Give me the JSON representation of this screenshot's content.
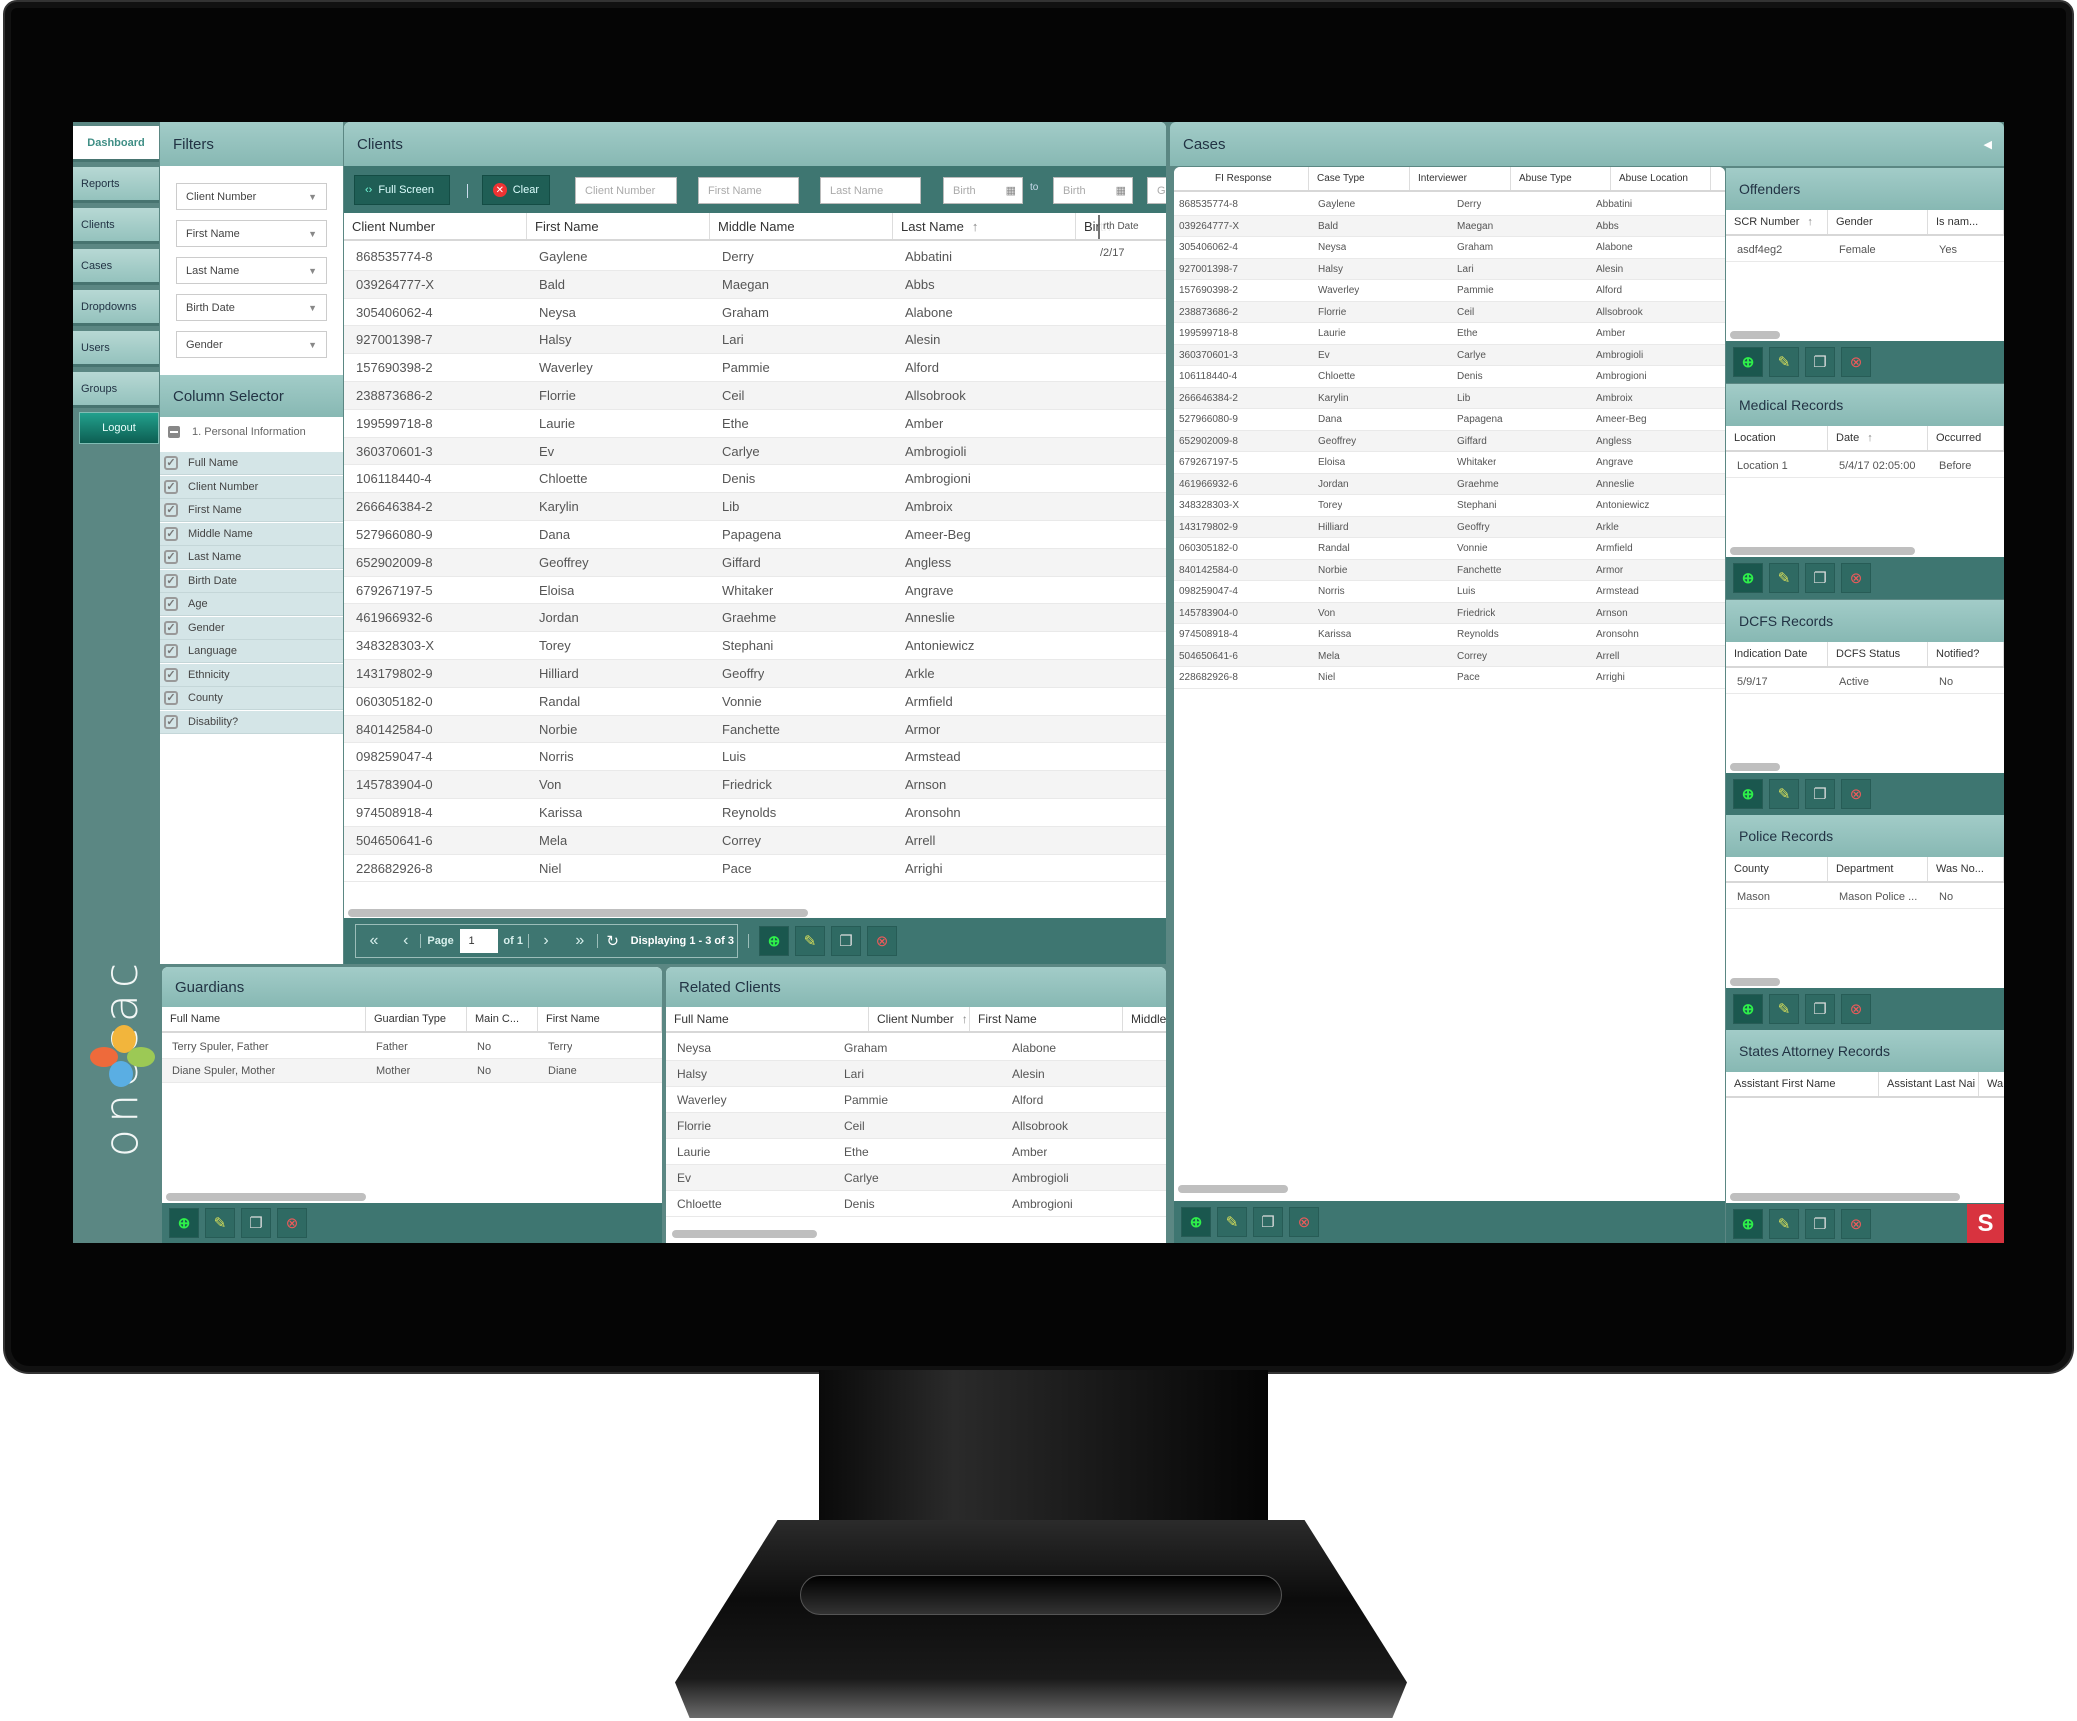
{
  "nav": {
    "items": [
      "Dashboard",
      "Reports",
      "Clients",
      "Cases",
      "Dropdowns",
      "Users",
      "Groups"
    ],
    "active": "Dashboard",
    "logout": "Logout"
  },
  "logo": {
    "text": "onecac",
    "tm": "™"
  },
  "filters": {
    "title": "Filters",
    "dropdowns": [
      "Client Number",
      "First Name",
      "Last Name",
      "Birth Date",
      "Gender"
    ]
  },
  "column_selector": {
    "title": "Column Selector",
    "group": "1. Personal Information",
    "items": [
      "Full Name",
      "Client Number",
      "First Name",
      "Middle Name",
      "Last Name",
      "Birth Date",
      "Age",
      "Gender",
      "Language",
      "Ethnicity",
      "County",
      "Disability?"
    ]
  },
  "clients": {
    "title": "Clients",
    "toolbar": {
      "full_screen": "Full Screen",
      "clear": "Clear",
      "client_number_placeholder": "Client Number",
      "first_name_placeholder": "First Name",
      "last_name_placeholder": "Last Name",
      "birth_from_placeholder": "Birth",
      "to": "to",
      "birth_to_placeholder": "Birth",
      "next_field_partial": "G"
    },
    "columns": [
      "Client Number",
      "First Name",
      "Middle Name",
      "Last Name",
      "Birth"
    ],
    "sorted_column": "Last Name",
    "dragged_header": "rth Date",
    "birth_partial_value": "/2/17",
    "rows": [
      [
        "868535774-8",
        "Gaylene",
        "Derry",
        "Abbatini"
      ],
      [
        "039264777-X",
        "Bald",
        "Maegan",
        "Abbs"
      ],
      [
        "305406062-4",
        "Neysa",
        "Graham",
        "Alabone"
      ],
      [
        "927001398-7",
        "Halsy",
        "Lari",
        "Alesin"
      ],
      [
        "157690398-2",
        "Waverley",
        "Pammie",
        "Alford"
      ],
      [
        "238873686-2",
        "Florrie",
        "Ceil",
        "Allsobrook"
      ],
      [
        "199599718-8",
        "Laurie",
        "Ethe",
        "Amber"
      ],
      [
        "360370601-3",
        "Ev",
        "Carlye",
        "Ambrogioli"
      ],
      [
        "106118440-4",
        "Chloette",
        "Denis",
        "Ambrogioni"
      ],
      [
        "266646384-2",
        "Karylin",
        "Lib",
        "Ambroix"
      ],
      [
        "527966080-9",
        "Dana",
        "Papagena",
        "Ameer-Beg"
      ],
      [
        "652902009-8",
        "Geoffrey",
        "Giffard",
        "Angless"
      ],
      [
        "679267197-5",
        "Eloisa",
        "Whitaker",
        "Angrave"
      ],
      [
        "461966932-6",
        "Jordan",
        "Graehme",
        "Anneslie"
      ],
      [
        "348328303-X",
        "Torey",
        "Stephani",
        "Antoniewicz"
      ],
      [
        "143179802-9",
        "Hilliard",
        "Geoffry",
        "Arkle"
      ],
      [
        "060305182-0",
        "Randal",
        "Vonnie",
        "Armfield"
      ],
      [
        "840142584-0",
        "Norbie",
        "Fanchette",
        "Armor"
      ],
      [
        "098259047-4",
        "Norris",
        "Luis",
        "Armstead"
      ],
      [
        "145783904-0",
        "Von",
        "Friedrick",
        "Arnson"
      ],
      [
        "974508918-4",
        "Karissa",
        "Reynolds",
        "Aronsohn"
      ],
      [
        "504650641-6",
        "Mela",
        "Correy",
        "Arrell"
      ],
      [
        "228682926-8",
        "Niel",
        "Pace",
        "Arrighi"
      ]
    ],
    "pager": {
      "page_label": "Page",
      "page_value": "1",
      "of": "of 1",
      "display": "Displaying 1 - 3 of 3"
    }
  },
  "guardians": {
    "title": "Guardians",
    "columns": [
      "Full Name",
      "Guardian Type",
      "Main C...",
      "First Name"
    ],
    "rows": [
      [
        "Terry Spuler, Father",
        "Father",
        "No",
        "Terry"
      ],
      [
        "Diane Spuler, Mother",
        "Mother",
        "No",
        "Diane"
      ]
    ]
  },
  "related_clients": {
    "title": "Related Clients",
    "columns": [
      "Full Name",
      "Client Number",
      "First Name",
      "Middle"
    ],
    "sorted_column": "Client Number",
    "rows": [
      [
        "Neysa",
        "Graham",
        "Alabone"
      ],
      [
        "Halsy",
        "Lari",
        "Alesin"
      ],
      [
        "Waverley",
        "Pammie",
        "Alford"
      ],
      [
        "Florrie",
        "Ceil",
        "Allsobrook"
      ],
      [
        "Laurie",
        "Ethe",
        "Amber"
      ],
      [
        "Ev",
        "Carlye",
        "Ambrogioli"
      ],
      [
        "Chloette",
        "Denis",
        "Ambrogioni"
      ]
    ]
  },
  "cases": {
    "title": "Cases",
    "columns": [
      "FI Response",
      "Case Type",
      "Interviewer",
      "Abuse Type",
      "Abuse Location"
    ],
    "rows": [
      [
        "868535774-8",
        "Gaylene",
        "Derry",
        "Abbatini"
      ],
      [
        "039264777-X",
        "Bald",
        "Maegan",
        "Abbs"
      ],
      [
        "305406062-4",
        "Neysa",
        "Graham",
        "Alabone"
      ],
      [
        "927001398-7",
        "Halsy",
        "Lari",
        "Alesin"
      ],
      [
        "157690398-2",
        "Waverley",
        "Pammie",
        "Alford"
      ],
      [
        "238873686-2",
        "Florrie",
        "Ceil",
        "Allsobrook"
      ],
      [
        "199599718-8",
        "Laurie",
        "Ethe",
        "Amber"
      ],
      [
        "360370601-3",
        "Ev",
        "Carlye",
        "Ambrogioli"
      ],
      [
        "106118440-4",
        "Chloette",
        "Denis",
        "Ambrogioni"
      ],
      [
        "266646384-2",
        "Karylin",
        "Lib",
        "Ambroix"
      ],
      [
        "527966080-9",
        "Dana",
        "Papagena",
        "Ameer-Beg"
      ],
      [
        "652902009-8",
        "Geoffrey",
        "Giffard",
        "Angless"
      ],
      [
        "679267197-5",
        "Eloisa",
        "Whitaker",
        "Angrave"
      ],
      [
        "461966932-6",
        "Jordan",
        "Graehme",
        "Anneslie"
      ],
      [
        "348328303-X",
        "Torey",
        "Stephani",
        "Antoniewicz"
      ],
      [
        "143179802-9",
        "Hilliard",
        "Geoffry",
        "Arkle"
      ],
      [
        "060305182-0",
        "Randal",
        "Vonnie",
        "Armfield"
      ],
      [
        "840142584-0",
        "Norbie",
        "Fanchette",
        "Armor"
      ],
      [
        "098259047-4",
        "Norris",
        "Luis",
        "Armstead"
      ],
      [
        "145783904-0",
        "Von",
        "Friedrick",
        "Arnson"
      ],
      [
        "974508918-4",
        "Karissa",
        "Reynolds",
        "Aronsohn"
      ],
      [
        "504650641-6",
        "Mela",
        "Correy",
        "Arrell"
      ],
      [
        "228682926-8",
        "Niel",
        "Pace",
        "Arrighi"
      ]
    ]
  },
  "subpanels": [
    {
      "key": "offenders",
      "title": "Offenders",
      "columns": [
        "SCR Number",
        "Gender",
        "Is nam..."
      ],
      "sorted": 0,
      "rows": [
        [
          "asdf4eg2",
          "Female",
          "Yes"
        ]
      ]
    },
    {
      "key": "medical-records",
      "title": "Medical Records",
      "columns": [
        "Location",
        "Date",
        "Occurred"
      ],
      "sorted": 1,
      "rows": [
        [
          "Location 1",
          "5/4/17 02:05:00",
          "Before"
        ]
      ]
    },
    {
      "key": "dcfs-records",
      "title": "DCFS Records",
      "columns": [
        "Indication Date",
        "DCFS Status",
        "Notified?"
      ],
      "sorted": -1,
      "rows": [
        [
          "5/9/17",
          "Active",
          "No"
        ]
      ]
    },
    {
      "key": "police-records",
      "title": "Police Records",
      "columns": [
        "County",
        "Department",
        "Was No..."
      ],
      "sorted": -1,
      "rows": [
        [
          "Mason",
          "Mason Police ...",
          "No"
        ]
      ]
    },
    {
      "key": "states-attorney-records",
      "title": "States Attorney Records",
      "columns": [
        "Assistant First Name",
        "Assistant Last Nai",
        "Wa"
      ],
      "sorted": -1,
      "rows": []
    }
  ],
  "actions": {
    "add": "add-icon",
    "edit": "pencil-icon",
    "copy": "copy-icon",
    "delete": "delete-icon"
  },
  "colors": {
    "header_teal": "#9cc9c5",
    "toolbar_teal": "#3e7671",
    "nav_bg": "#5b8783",
    "add_green": "#2ef04a",
    "delete_red": "#f05a5a",
    "brand_red": "#d8333f"
  }
}
